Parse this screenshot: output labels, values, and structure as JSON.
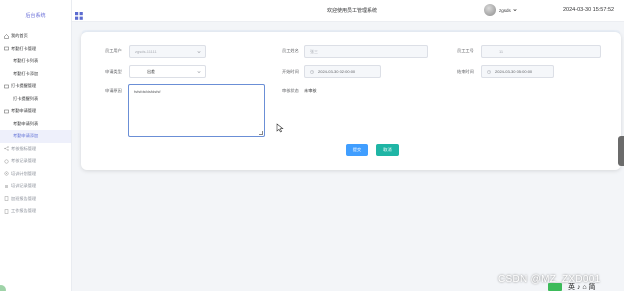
{
  "sidebar": {
    "brand": "后台系统",
    "items": [
      {
        "label": "我的首页",
        "type": "top"
      },
      {
        "label": "考勤打卡管理",
        "type": "top"
      },
      {
        "label": "考勤打卡列表",
        "type": "sub"
      },
      {
        "label": "考勤打卡添加",
        "type": "sub"
      },
      {
        "label": "打卡提醒管理",
        "type": "top"
      },
      {
        "label": "打卡提醒列表",
        "type": "sub"
      },
      {
        "label": "考勤申请管理",
        "type": "top"
      },
      {
        "label": "考勤申请列表",
        "type": "sub"
      },
      {
        "label": "考勤申请添加",
        "type": "sub-active"
      },
      {
        "label": "考核指标管理",
        "type": "dim"
      },
      {
        "label": "考核记录管理",
        "type": "dim"
      },
      {
        "label": "培训计划管理",
        "type": "dim"
      },
      {
        "label": "培训记录管理",
        "type": "dim"
      },
      {
        "label": "加班报告管理",
        "type": "dim"
      },
      {
        "label": "工作报告管理",
        "type": "dim"
      }
    ]
  },
  "header": {
    "title": "欢迎使用员工管理系统",
    "username": "zgsds",
    "datetime": "2024-03-30 15:57:52"
  },
  "form": {
    "employee_user_label": "员工用户",
    "employee_user_value": "zgsds-11111",
    "employee_name_label": "员工姓名",
    "employee_name_value": "张三",
    "employee_no_label": "员工工号",
    "employee_no_value": "11",
    "apply_type_label": "申请类型",
    "apply_type_value": "出差",
    "start_time_label": "开始时间",
    "start_time_value": "2024-03-30 02:00:00",
    "end_time_label": "结束时间",
    "end_time_value": "2024-03-30 05:00:00",
    "reason_label": "申请原因",
    "reason_value": "fsfsfdsfdsfdsfsf",
    "review_status_label": "审核状态",
    "review_status_value": "未审核",
    "submit_label": "提交",
    "cancel_label": "取消"
  },
  "watermark": "CSDN @MZ_ZXD001",
  "taskbar_text": "英 ♪ ⌂ 简"
}
